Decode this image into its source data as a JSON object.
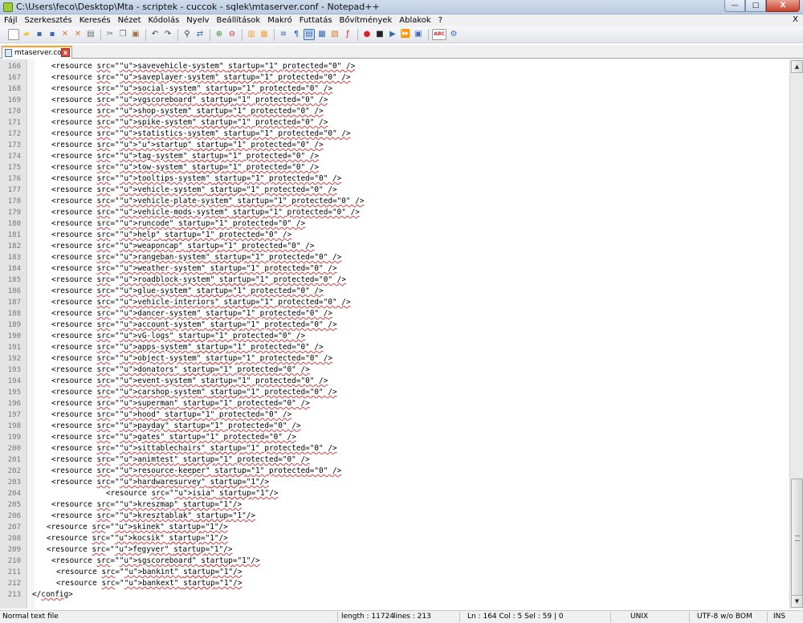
{
  "window": {
    "title": "C:\\Users\\feco\\Desktop\\Mta - scriptek - cuccok - sqlek\\mtaserver.conf - Notepad++",
    "minimize": "—",
    "maximize": "□",
    "close": "X"
  },
  "menu": {
    "items": [
      "Fájl",
      "Szerkesztés",
      "Keresés",
      "Nézet",
      "Kódolás",
      "Nyelv",
      "Beállítások",
      "Makró",
      "Futtatás",
      "Bővítmények",
      "Ablakok",
      "?"
    ],
    "close": "X"
  },
  "toolbar": {
    "colors": {
      "accent": "#f5a623",
      "record": "#e02020"
    },
    "buttons": [
      {
        "name": "new-icon",
        "glyph": "▫",
        "color": "#ffffff"
      },
      {
        "name": "open-icon",
        "glyph": "▰",
        "color": "#f3c14a"
      },
      {
        "name": "save-icon",
        "glyph": "▪",
        "color": "#3b6ab5"
      },
      {
        "name": "save-all-icon",
        "glyph": "▪",
        "color": "#3b6ab5"
      },
      {
        "name": "close-file-icon",
        "glyph": "✕",
        "color": "#e07040"
      },
      {
        "name": "close-all-icon",
        "glyph": "✕",
        "color": "#e07040"
      },
      {
        "name": "print-icon",
        "glyph": "▤",
        "color": "#6b6b6b"
      },
      {
        "sep": true
      },
      {
        "name": "cut-icon",
        "glyph": "✂",
        "color": "#6b6b6b"
      },
      {
        "name": "copy-icon",
        "glyph": "❐",
        "color": "#6b6b6b"
      },
      {
        "name": "paste-icon",
        "glyph": "▣",
        "color": "#a0703a"
      },
      {
        "sep": true
      },
      {
        "name": "undo-icon",
        "glyph": "↶",
        "color": "#444444"
      },
      {
        "name": "redo-icon",
        "glyph": "↷",
        "color": "#444444"
      },
      {
        "sep": true
      },
      {
        "name": "find-icon",
        "glyph": "⚲",
        "color": "#333333"
      },
      {
        "name": "replace-icon",
        "glyph": "⇄",
        "color": "#3b6ab5"
      },
      {
        "sep": true
      },
      {
        "name": "zoom-in-icon",
        "glyph": "⊕",
        "color": "#2f8f2f"
      },
      {
        "name": "zoom-out-icon",
        "glyph": "⊖",
        "color": "#c03030"
      },
      {
        "sep": true
      },
      {
        "name": "sync-vertical-icon",
        "glyph": "▥",
        "color": "#f3a23a"
      },
      {
        "name": "sync-horizontal-icon",
        "glyph": "▦",
        "color": "#f3a23a"
      },
      {
        "sep": true
      },
      {
        "name": "word-wrap-icon",
        "glyph": "≡",
        "color": "#3b6ab5"
      },
      {
        "name": "show-all-chars-icon",
        "glyph": "¶",
        "color": "#3b6ab5"
      },
      {
        "name": "indent-guide-icon",
        "glyph": "▤",
        "color": "#3b6ab5",
        "active": true
      },
      {
        "name": "user-lang-icon",
        "glyph": "▩",
        "color": "#3b6ab5"
      },
      {
        "name": "doc-map-icon",
        "glyph": "▧",
        "color": "#d08030"
      },
      {
        "name": "function-list-icon",
        "glyph": "ƒ",
        "color": "#c03030"
      },
      {
        "sep": true
      },
      {
        "name": "record-macro-icon",
        "glyph": "●",
        "color": "#e02020"
      },
      {
        "name": "stop-macro-icon",
        "glyph": "■",
        "color": "#222222"
      },
      {
        "name": "play-macro-icon",
        "glyph": "▶",
        "color": "#3b6ab5"
      },
      {
        "name": "play-multiple-icon",
        "glyph": "⏩",
        "color": "#3b6ab5"
      },
      {
        "name": "save-macro-icon",
        "glyph": "▣",
        "color": "#3b6ab5"
      },
      {
        "sep": true
      },
      {
        "name": "spell-check-icon",
        "glyph": "ABC",
        "color": "#c03030"
      },
      {
        "name": "spell-check-settings-icon",
        "glyph": "⚙",
        "color": "#3b6ab5"
      }
    ]
  },
  "tab": {
    "label": "mtaserver.conf",
    "close": "x"
  },
  "editor": {
    "lines": [
      {
        "n": "166",
        "indent": 64,
        "text": "<resource src=\"savevehicle-system\" startup=\"1\" protected=\"0\" />"
      },
      {
        "n": "167",
        "indent": 64,
        "text": "<resource src=\"saveplayer-system\" startup=\"1\" protected=\"0\" />"
      },
      {
        "n": "168",
        "indent": 64,
        "text": "<resource src=\"social-system\" startup=\"1\" protected=\"0\" />"
      },
      {
        "n": "169",
        "indent": 64,
        "text": "<resource src=\"vgscoreboard\" startup=\"1\" protected=\"0\" />"
      },
      {
        "n": "170",
        "indent": 64,
        "text": "<resource src=\"shop-system\" startup=\"1\" protected=\"0\" />"
      },
      {
        "n": "171",
        "indent": 64,
        "text": "<resource src=\"spike-system\" startup=\"1\" protected=\"0\" />"
      },
      {
        "n": "172",
        "indent": 64,
        "text": "<resource src=\"statistics-system\" startup=\"1\" protected=\"0\" />"
      },
      {
        "n": "173",
        "indent": 64,
        "text": "<resource src=\"startup\" startup=\"1\" protected=\"0\" />"
      },
      {
        "n": "174",
        "indent": 64,
        "text": "<resource src=\"tag-system\" startup=\"1\" protected=\"0\" />"
      },
      {
        "n": "175",
        "indent": 64,
        "text": "<resource src=\"tow-system\" startup=\"1\" protected=\"0\" />"
      },
      {
        "n": "176",
        "indent": 64,
        "text": "<resource src=\"tooltips-system\" startup=\"1\" protected=\"0\" />"
      },
      {
        "n": "177",
        "indent": 64,
        "text": "<resource src=\"vehicle-system\" startup=\"1\" protected=\"0\" />"
      },
      {
        "n": "178",
        "indent": 64,
        "text": "<resource src=\"vehicle-plate-system\" startup=\"1\" protected=\"0\" />"
      },
      {
        "n": "179",
        "indent": 64,
        "text": "<resource src=\"vehicle-mods-system\" startup=\"1\" protected=\"0\" />"
      },
      {
        "n": "180",
        "indent": 64,
        "text": "<resource src=\"runcode\" startup=\"1\" protected=\"0\" />"
      },
      {
        "n": "181",
        "indent": 64,
        "text": "<resource src=\"help\" startup=\"1\" protected=\"0\" />"
      },
      {
        "n": "182",
        "indent": 64,
        "text": "<resource src=\"weaponcap\" startup=\"1\" protected=\"0\" />"
      },
      {
        "n": "183",
        "indent": 64,
        "text": "<resource src=\"rangeban-system\" startup=\"1\" protected=\"0\" />"
      },
      {
        "n": "184",
        "indent": 64,
        "text": "<resource src=\"weather-system\" startup=\"1\" protected=\"0\" />"
      },
      {
        "n": "185",
        "indent": 64,
        "text": "<resource src=\"roadblock-system\" startup=\"1\" protected=\"0\" />"
      },
      {
        "n": "186",
        "indent": 64,
        "text": "<resource src=\"glue-system\" startup=\"1\" protected=\"0\" />"
      },
      {
        "n": "187",
        "indent": 64,
        "text": "<resource src=\"vehicle-interiors\" startup=\"1\" protected=\"0\" />"
      },
      {
        "n": "188",
        "indent": 64,
        "text": "<resource src=\"dancer-system\" startup=\"1\" protected=\"0\" />"
      },
      {
        "n": "189",
        "indent": 64,
        "text": "<resource src=\"account-system\" startup=\"1\" protected=\"0\" />"
      },
      {
        "n": "190",
        "indent": 64,
        "text": "<resource src=\"vG-logs\" startup=\"1\" protected=\"0\" />"
      },
      {
        "n": "191",
        "indent": 64,
        "text": "<resource src=\"apps-system\" startup=\"1\" protected=\"0\" />"
      },
      {
        "n": "192",
        "indent": 64,
        "text": "<resource src=\"object-system\" startup=\"1\" protected=\"0\" />"
      },
      {
        "n": "193",
        "indent": 64,
        "text": "<resource src=\"donators\" startup=\"1\" protected=\"0\" />"
      },
      {
        "n": "194",
        "indent": 64,
        "text": "<resource src=\"event-system\" startup=\"1\" protected=\"0\" />"
      },
      {
        "n": "195",
        "indent": 64,
        "text": "<resource src=\"carshop-system\" startup=\"1\" protected=\"0\" />"
      },
      {
        "n": "196",
        "indent": 64,
        "text": "<resource src=\"superman\" startup=\"1\" protected=\"0\" />"
      },
      {
        "n": "197",
        "indent": 64,
        "text": "<resource src=\"hood\" startup=\"1\" protected=\"0\" />"
      },
      {
        "n": "198",
        "indent": 64,
        "text": "<resource src=\"payday\" startup=\"1\" protected=\"0\" />"
      },
      {
        "n": "199",
        "indent": 64,
        "text": "<resource src=\"gates\" startup=\"1\" protected=\"0\" />"
      },
      {
        "n": "200",
        "indent": 64,
        "text": "<resource src=\"sittablechairs\" startup=\"1\" protected=\"0\" />"
      },
      {
        "n": "201",
        "indent": 64,
        "text": "<resource src=\"animtest\" startup=\"1\" protected=\"0\" />"
      },
      {
        "n": "202",
        "indent": 64,
        "text": "<resource src=\"resource-keeper\" startup=\"1\" protected=\"0\" />"
      },
      {
        "n": "203",
        "indent": 64,
        "text": "<resource src=\"hardwaresurvey\" startup=\"1\"/>"
      },
      {
        "n": "204",
        "indent": 132,
        "text": "<resource src=\"isia\" startup=\"1\"/>"
      },
      {
        "n": "205",
        "indent": 64,
        "text": "<resource src=\"kreszmap\" startup=\"1\"/>"
      },
      {
        "n": "206",
        "indent": 64,
        "text": "<resource src=\"kresztablak\" startup=\"1\"/>"
      },
      {
        "n": "207",
        "indent": 58,
        "text": "<resource src=\"skinek\" startup=\"1\"/>"
      },
      {
        "n": "208",
        "indent": 58,
        "text": "<resource src=\"kocsik\" startup=\"1\"/>"
      },
      {
        "n": "209",
        "indent": 58,
        "text": "<resource src=\"fegyver\" startup=\"1\"/>"
      },
      {
        "n": "210",
        "indent": 64,
        "text": "<resource src=\"sgscoreboard\" startup=\"1\"/>"
      },
      {
        "n": "211",
        "indent": 70,
        "text": "<resource src=\"bankint\" startup=\"1\"/>"
      },
      {
        "n": "212",
        "indent": 70,
        "text": "<resource src=\"bankext\" startup=\"1\"/>"
      },
      {
        "n": "213",
        "indent": 40,
        "text": "</config>"
      }
    ]
  },
  "statusbar": {
    "type": "Normal text file",
    "length": "length : 11724",
    "lines": "lines : 213",
    "position": "Ln : 164    Col : 5    Sel : 59 | 0",
    "eol": "UNIX",
    "encoding": "UTF-8 w/o BOM",
    "mode": "INS"
  }
}
